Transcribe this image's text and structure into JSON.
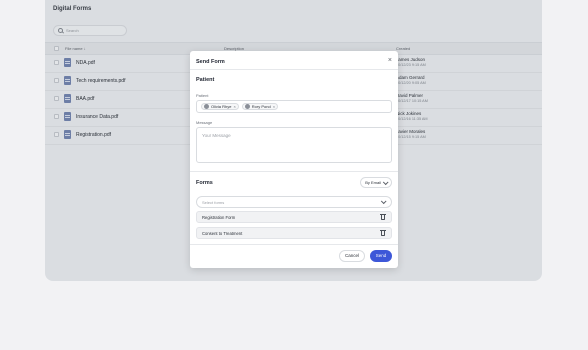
{
  "page": {
    "title": "Digital Forms"
  },
  "search": {
    "placeholder": "Search"
  },
  "table": {
    "columns": [
      "File name ↓",
      "Description",
      "Created"
    ],
    "rows": [
      {
        "file": "NDA.pdf",
        "created_by": "James Judson",
        "created_at": "10/12/23 9:15 AM"
      },
      {
        "file": "Tech requirements.pdf",
        "created_by": "Adam Gerrard",
        "created_at": "10/12/20 9:05 AM"
      },
      {
        "file": "BAA.pdf",
        "created_by": "David Palmer",
        "created_at": "10/12/17 10:15 AM"
      },
      {
        "file": "Insurance Data.pdf",
        "created_by": "Nick Jokines",
        "created_at": "10/12/16 11:35 AM"
      },
      {
        "file": "Registration.pdf",
        "created_by": "Javier Morales",
        "created_at": "10/12/15 9:15 AM"
      }
    ]
  },
  "modal": {
    "title": "Send Form",
    "close_icon": "close-icon",
    "patient_section": "Patient",
    "patient_label": "Patient",
    "patients": [
      "Olivia Rhye",
      "Rory Pond"
    ],
    "message_label": "Message",
    "message_placeholder": "Your Message",
    "forms_section": "Forms",
    "delivery_method": "By Email",
    "select_placeholder": "Select forms",
    "forms": [
      "Registration Form",
      "Consent to Treatment"
    ],
    "cancel_label": "Cancel",
    "send_label": "Send"
  },
  "colors": {
    "accent": "#3d57d8",
    "overlay": "#dadde1"
  }
}
